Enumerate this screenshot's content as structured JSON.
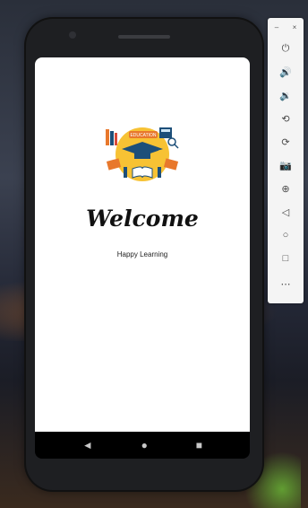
{
  "app": {
    "welcome_title": "Welcome",
    "subtitle": "Happy Learning",
    "logo_banner_text": "EDUCATION"
  },
  "navbar": {
    "back_icon": "◄",
    "home_icon": "●",
    "recents_icon": "■"
  },
  "emulator_toolbar": {
    "minimize": "–",
    "close": "×",
    "buttons": [
      {
        "name": "power-icon",
        "glyph": "⏻"
      },
      {
        "name": "volume-up-icon",
        "glyph": "🔊"
      },
      {
        "name": "volume-down-icon",
        "glyph": "🔉"
      },
      {
        "name": "rotate-left-icon",
        "glyph": "⟲"
      },
      {
        "name": "rotate-right-icon",
        "glyph": "⟳"
      },
      {
        "name": "camera-icon",
        "glyph": "📷"
      },
      {
        "name": "zoom-icon",
        "glyph": "⊕"
      },
      {
        "name": "back-icon",
        "glyph": "◁"
      },
      {
        "name": "home-icon",
        "glyph": "○"
      },
      {
        "name": "overview-icon",
        "glyph": "□"
      },
      {
        "name": "more-icon",
        "glyph": "⋯"
      }
    ]
  },
  "colors": {
    "logo_yellow": "#f7c234",
    "logo_navy": "#1d4f79",
    "logo_orange": "#e8782c"
  }
}
